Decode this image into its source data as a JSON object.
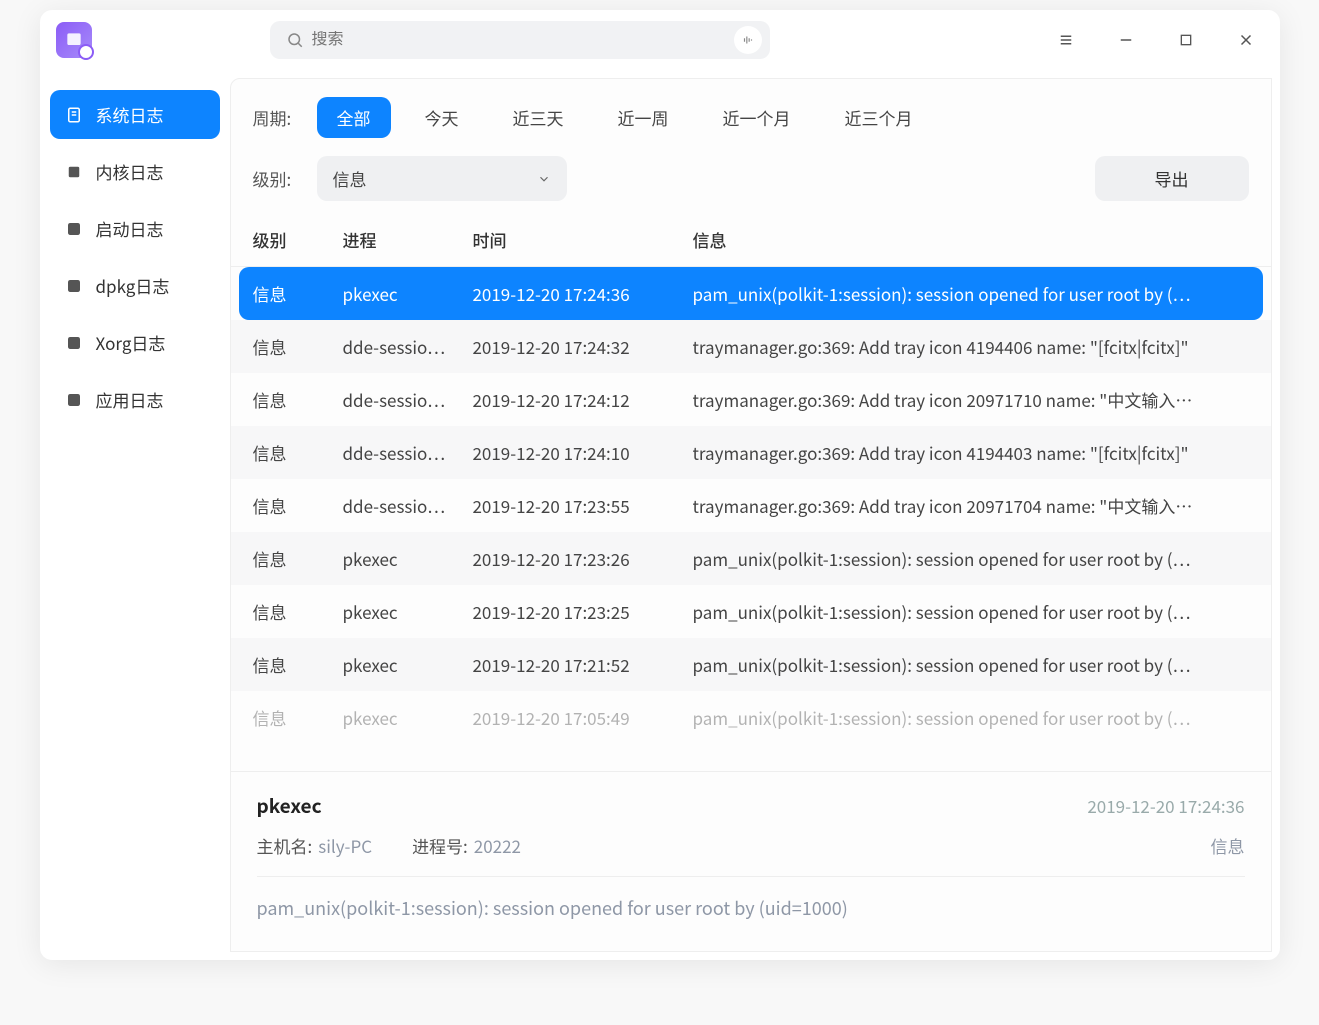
{
  "search": {
    "placeholder": "搜索"
  },
  "sidebar": {
    "items": [
      {
        "label": "系统日志",
        "active": true,
        "icon": "doc"
      },
      {
        "label": "内核日志",
        "active": false,
        "icon": "chip"
      },
      {
        "label": "启动日志",
        "active": false,
        "icon": "power"
      },
      {
        "label": "dpkg日志",
        "active": false,
        "icon": "d"
      },
      {
        "label": "Xorg日志",
        "active": false,
        "icon": "x"
      },
      {
        "label": "应用日志",
        "active": false,
        "icon": "app"
      }
    ]
  },
  "filters": {
    "period_label": "周期:",
    "periods": [
      "全部",
      "今天",
      "近三天",
      "近一周",
      "近一个月",
      "近三个月"
    ],
    "period_active": 0,
    "level_label": "级别:",
    "level_value": "信息",
    "export_label": "导出"
  },
  "table": {
    "headers": {
      "level": "级别",
      "process": "进程",
      "time": "时间",
      "message": "信息"
    },
    "rows": [
      {
        "level": "信息",
        "process": "pkexec",
        "time": "2019-12-20 17:24:36",
        "message": "pam_unix(polkit-1:session): session opened for user root by (…",
        "selected": true
      },
      {
        "level": "信息",
        "process": "dde-sessio…",
        "time": "2019-12-20 17:24:32",
        "message": "traymanager.go:369: Add tray icon 4194406 name: \"[fcitx|fcitx]\""
      },
      {
        "level": "信息",
        "process": "dde-sessio…",
        "time": "2019-12-20 17:24:12",
        "message": "traymanager.go:369: Add tray icon 20971710 name: \"中文输入…"
      },
      {
        "level": "信息",
        "process": "dde-sessio…",
        "time": "2019-12-20 17:24:10",
        "message": "traymanager.go:369: Add tray icon 4194403 name: \"[fcitx|fcitx]\""
      },
      {
        "level": "信息",
        "process": "dde-sessio…",
        "time": "2019-12-20 17:23:55",
        "message": "traymanager.go:369: Add tray icon 20971704 name: \"中文输入…"
      },
      {
        "level": "信息",
        "process": "pkexec",
        "time": "2019-12-20 17:23:26",
        "message": "pam_unix(polkit-1:session): session opened for user root by (…"
      },
      {
        "level": "信息",
        "process": "pkexec",
        "time": "2019-12-20 17:23:25",
        "message": "pam_unix(polkit-1:session): session opened for user root by (…"
      },
      {
        "level": "信息",
        "process": "pkexec",
        "time": "2019-12-20 17:21:52",
        "message": "pam_unix(polkit-1:session): session opened for user root by (…"
      },
      {
        "level": "信息",
        "process": "pkexec",
        "time": "2019-12-20 17:05:49",
        "message": "pam_unix(polkit-1:session): session opened for user root by (…",
        "cut": true
      }
    ]
  },
  "detail": {
    "process": "pkexec",
    "time": "2019-12-20 17:24:36",
    "host_label": "主机名:",
    "host": "sily-PC",
    "pid_label": "进程号:",
    "pid": "20222",
    "level": "信息",
    "message": "pam_unix(polkit-1:session): session opened for user root by (uid=1000)"
  }
}
